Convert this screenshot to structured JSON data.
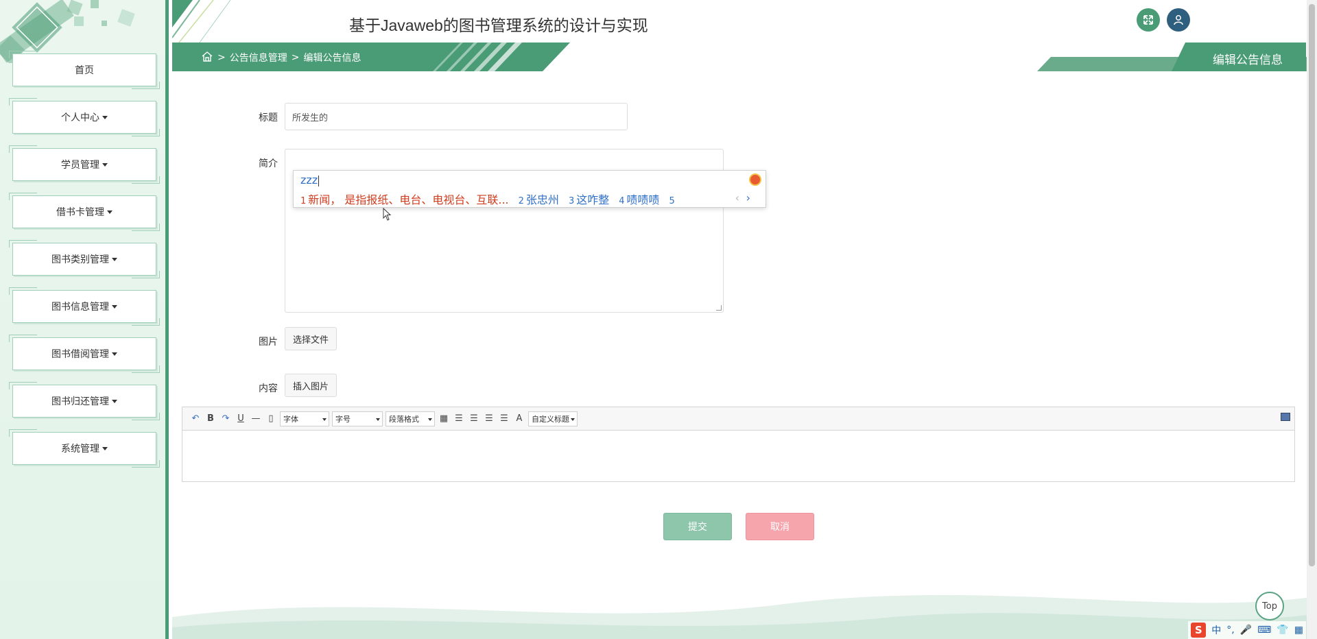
{
  "colors": {
    "accent": "#4a9c77",
    "submit": "#8ec6ac",
    "cancel": "#f6a5ad",
    "user_button": "#2f5f7f",
    "ime_highlight": "#d03d1e",
    "ime_text": "#3070c8"
  },
  "header": {
    "title": "基于Javaweb的图书管理系统的设计与实现",
    "breadcrumb": {
      "home_icon": "home-icon",
      "separator": ">",
      "items": [
        "公告信息管理",
        "编辑公告信息"
      ]
    },
    "page_tab": "编辑公告信息",
    "icons": [
      "expand-icon",
      "user-icon"
    ]
  },
  "sidebar": {
    "items": [
      {
        "label": "首页",
        "dropdown": false
      },
      {
        "label": "个人中心",
        "dropdown": true
      },
      {
        "label": "学员管理",
        "dropdown": true
      },
      {
        "label": "借书卡管理",
        "dropdown": true
      },
      {
        "label": "图书类别管理",
        "dropdown": true
      },
      {
        "label": "图书信息管理",
        "dropdown": true
      },
      {
        "label": "图书借阅管理",
        "dropdown": true
      },
      {
        "label": "图书归还管理",
        "dropdown": true
      },
      {
        "label": "系统管理",
        "dropdown": true
      }
    ]
  },
  "form": {
    "title_label": "标题",
    "title_value": "所发生的",
    "intro_label": "简介",
    "image_label": "图片",
    "image_button": "选择文件",
    "content_label": "内容",
    "content_button": "插入图片",
    "submit": "提交",
    "cancel": "取消"
  },
  "editor": {
    "font_select": "字体",
    "size_select": "字号",
    "paragraph_select": "段落格式",
    "custom_title_select": "自定义标题"
  },
  "ime": {
    "input": "zzz",
    "candidates": [
      {
        "num": "1",
        "text": "新闻， 是指报纸、电台、电视台、互联..."
      },
      {
        "num": "2",
        "text": "张忠州"
      },
      {
        "num": "3",
        "text": "这咋整"
      },
      {
        "num": "4",
        "text": "啧啧啧"
      },
      {
        "num": "5",
        "text": ""
      }
    ]
  },
  "top_button": "Top",
  "tray": {
    "lang": "中",
    "punct": "°,"
  }
}
